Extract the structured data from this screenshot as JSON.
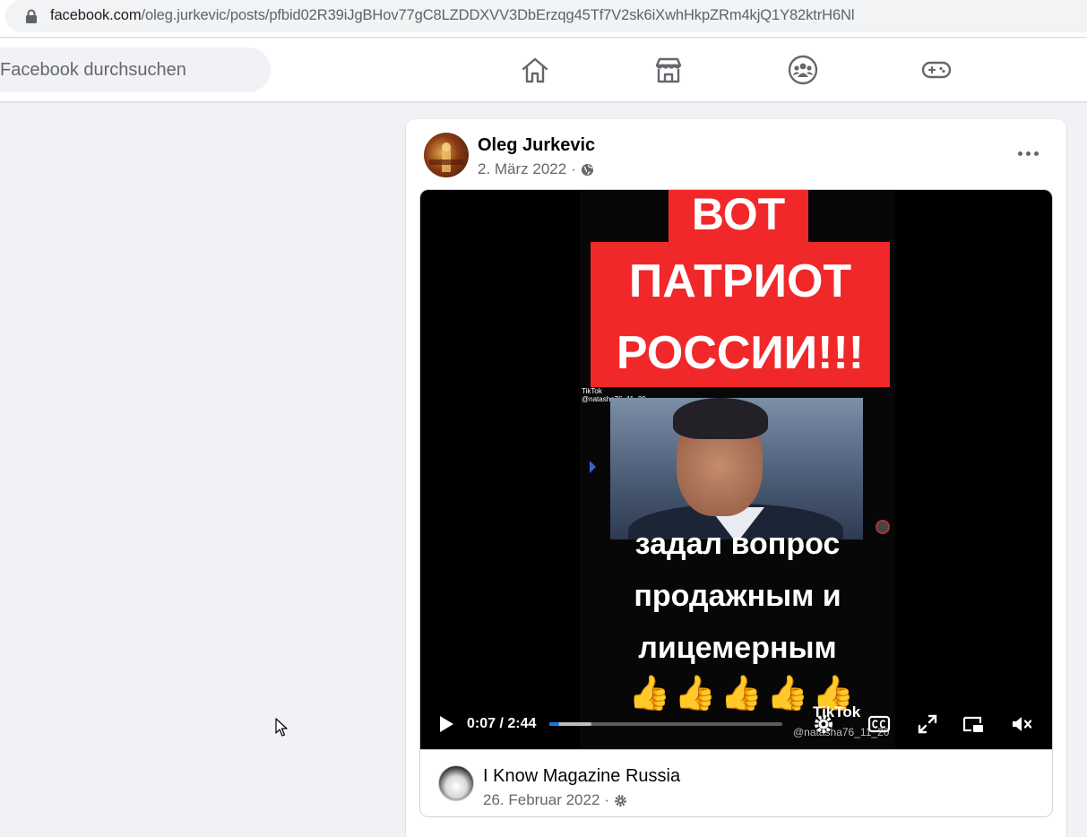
{
  "browser": {
    "url_host": "facebook.com",
    "url_path": "/oleg.jurkevic/posts/pfbid02R39iJgBHov77gC8LZDDXVV3DbErzqg45Tf7V2sk6iXwhHkpZRm4kjQ1Y82ktrH6Nl"
  },
  "nav": {
    "search_placeholder": "Facebook durchsuchen",
    "icons": [
      "home-icon",
      "marketplace-icon",
      "groups-icon",
      "gaming-icon"
    ]
  },
  "post": {
    "author": "Oleg Jurkevic",
    "date": "2. März 2022",
    "separator": "·",
    "privacy_icon": "globe-icon",
    "video": {
      "banner_lines": [
        "ВОТ",
        "ПАТРИОТ",
        "РОССИИ!!!"
      ],
      "subtitle_lines": [
        "задал вопрос",
        "продажным и",
        "лицемерным"
      ],
      "emoji": "👍👍👍👍👍",
      "watermark": "TikTok",
      "watermark_user": "@natasha76_11_20",
      "tiktok_small_brand": "TikTok",
      "tiktok_small_user": "@natasha76_11_20",
      "current_time": "0:07",
      "duration": "2:44",
      "time_separator": " / ",
      "progress_played": 0.043,
      "progress_buffered": 0.18,
      "accent_color": "#1b74e4",
      "banner_color": "#f0282a"
    },
    "source": {
      "name": "I Know Magazine Russia",
      "date": "26. Februar 2022",
      "separator": "·",
      "privacy_icon": "gear-icon"
    }
  }
}
